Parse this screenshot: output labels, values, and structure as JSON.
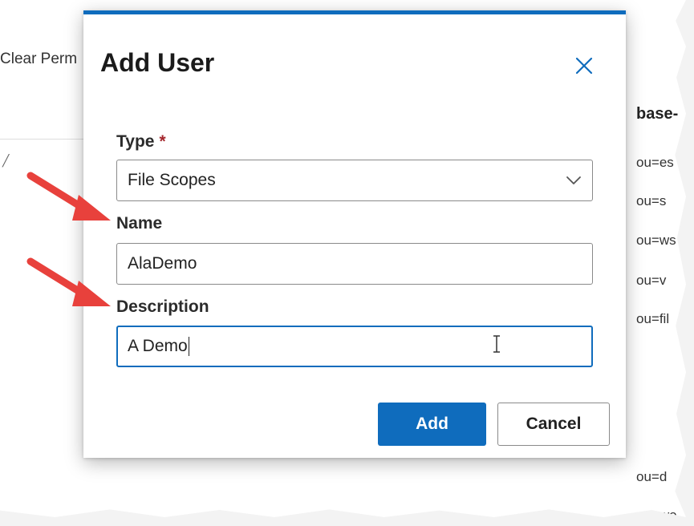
{
  "background": {
    "toolbar_text": "Clear Perm",
    "column_header": "base-",
    "column_cells": [
      "ou=es",
      "ou=s",
      "ou=ws",
      "ou=v",
      "ou=fil",
      "ou=d",
      "ou=wo"
    ],
    "row_marker": "╱"
  },
  "dialog": {
    "title": "Add User",
    "close_icon": "close-icon",
    "type_label": "Type",
    "type_required_marker": "*",
    "type_value": "File Scopes",
    "name_label": "Name",
    "name_value": "AlaDemo",
    "description_label": "Description",
    "description_value": "A Demo",
    "add_label": "Add",
    "cancel_label": "Cancel"
  },
  "colors": {
    "accent": "#0f6cbd",
    "required": "#a4262c",
    "arrow": "#e8413c"
  }
}
